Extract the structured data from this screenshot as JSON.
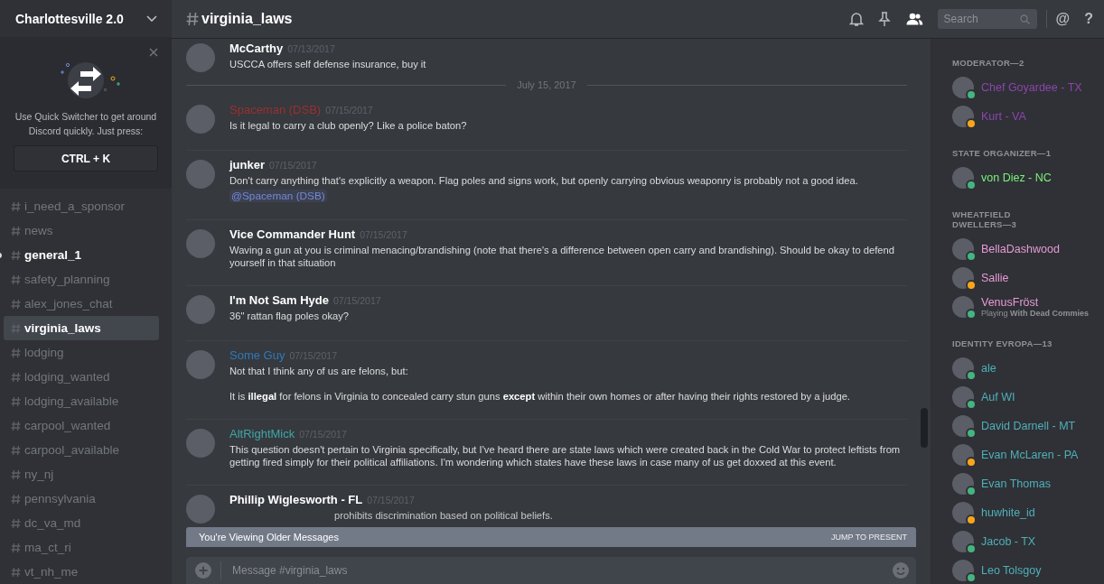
{
  "server": {
    "name": "Charlottesville 2.0"
  },
  "quick_switcher": {
    "text": "Use Quick Switcher to get around Discord quickly. Just press:",
    "shortcut": "CTRL + K"
  },
  "channels": [
    {
      "name": "i_need_a_sponsor",
      "unread": false,
      "selected": false
    },
    {
      "name": "news",
      "unread": false,
      "selected": false
    },
    {
      "name": "general_1",
      "unread": true,
      "selected": false
    },
    {
      "name": "safety_planning",
      "unread": false,
      "selected": false
    },
    {
      "name": "alex_jones_chat",
      "unread": false,
      "selected": false
    },
    {
      "name": "virginia_laws",
      "unread": false,
      "selected": true
    },
    {
      "name": "lodging",
      "unread": false,
      "selected": false
    },
    {
      "name": "lodging_wanted",
      "unread": false,
      "selected": false
    },
    {
      "name": "lodging_available",
      "unread": false,
      "selected": false
    },
    {
      "name": "carpool_wanted",
      "unread": false,
      "selected": false
    },
    {
      "name": "carpool_available",
      "unread": false,
      "selected": false
    },
    {
      "name": "ny_nj",
      "unread": false,
      "selected": false
    },
    {
      "name": "pennsylvania",
      "unread": false,
      "selected": false
    },
    {
      "name": "dc_va_md",
      "unread": false,
      "selected": false
    },
    {
      "name": "ma_ct_ri",
      "unread": false,
      "selected": false
    },
    {
      "name": "vt_nh_me",
      "unread": false,
      "selected": false
    }
  ],
  "header": {
    "channel": "virginia_laws",
    "search_placeholder": "Search",
    "mention_button": "@",
    "help_button": "?"
  },
  "messages": [
    {
      "kind": "message",
      "author": "McCarthy",
      "color": "#ffffff",
      "date": "07/13/2017",
      "lines": [
        {
          "kind": "text",
          "text": "USCCA offers self defense insurance, buy it"
        }
      ]
    },
    {
      "kind": "date_divider",
      "label": "July 15, 2017"
    },
    {
      "kind": "message",
      "author": "Spaceman (DSB)",
      "color": "#9a3030",
      "date": "07/15/2017",
      "lines": [
        {
          "kind": "text",
          "text": "Is it legal to carry a club openly? Like a police baton?"
        }
      ]
    },
    {
      "kind": "message",
      "author": "junker",
      "color": "#ffffff",
      "date": "07/15/2017",
      "lines": [
        {
          "kind": "text",
          "text": "Don't carry anything that's explicitly a weapon. Flag poles and signs work, but openly carrying obvious weaponry is probably not a good idea."
        },
        {
          "kind": "mention",
          "text": "@Spaceman (DSB)"
        }
      ]
    },
    {
      "kind": "message",
      "author": "Vice Commander Hunt",
      "color": "#ffffff",
      "date": "07/15/2017",
      "lines": [
        {
          "kind": "text",
          "text": "Waving a gun at you is criminal menacing/brandishing (note that there's a difference between open carry and brandishing). Should be okay to defend yourself in that situation"
        }
      ]
    },
    {
      "kind": "message",
      "author": "I'm Not Sam Hyde",
      "color": "#ffffff",
      "date": "07/15/2017",
      "lines": [
        {
          "kind": "text",
          "text": "36\" rattan flag poles okay?"
        }
      ]
    },
    {
      "kind": "message",
      "author": "Some Guy",
      "color": "#2f7ab8",
      "date": "07/15/2017",
      "lines": [
        {
          "kind": "text",
          "text": "Not that I think any of us are felons, but:"
        },
        {
          "kind": "text",
          "text": "It is **illegal** for felons in Virginia to concealed carry stun guns **except** within their own homes or after having their rights restored by a judge."
        }
      ]
    },
    {
      "kind": "message",
      "author": "AltRightMick",
      "color": "#3fa7a7",
      "date": "07/15/2017",
      "lines": [
        {
          "kind": "text",
          "text": "This question doesn't pertain to Virginia specifically, but I've heard there are state laws which were created back in the Cold War to protect leftists from getting fired simply for their political affiliations. I'm wondering which states have these laws in case many of us get doxxed at this event."
        }
      ]
    },
    {
      "kind": "message",
      "author": "Phillip Wiglesworth - FL",
      "color": "#ffffff",
      "date": "07/15/2017",
      "lines": [
        {
          "kind": "obscured",
          "text": "prohibits discrimination based on political beliefs."
        }
      ]
    }
  ],
  "older_banner": {
    "text": "You're Viewing Older Messages",
    "action": "JUMP TO PRESENT"
  },
  "composer": {
    "placeholder": "Message #virginia_laws"
  },
  "member_groups": [
    {
      "title": "MODERATOR—2",
      "color": "#8e44ad",
      "members": [
        {
          "name": "Chef Goyardee - TX",
          "color": "#43b581"
        },
        {
          "name": "Kurt - VA",
          "color": "#faa61a"
        }
      ]
    },
    {
      "title": "STATE ORGANIZER—1",
      "color": "#7cf07c",
      "members": [
        {
          "name": "von Diez - NC",
          "color": "#43b581"
        }
      ]
    },
    {
      "title": "WHEATFIELD DWELLERS—3",
      "color": "#e79ad6",
      "members": [
        {
          "name": "BellaDashwood",
          "color": "#43b581"
        },
        {
          "name": "Sallie",
          "color": "#faa61a"
        },
        {
          "name": "VenusFröst",
          "color": "#43b581",
          "activity": "Playing **With Dead Commies**"
        }
      ]
    },
    {
      "title": "IDENTITY EVROPA—13",
      "color": "#4fb0b8",
      "members": [
        {
          "name": "ale",
          "color": "#43b581"
        },
        {
          "name": "Auf WI",
          "color": "#43b581"
        },
        {
          "name": "David Darnell - MT",
          "color": "#43b581"
        },
        {
          "name": "Evan McLaren - PA",
          "color": "#faa61a"
        },
        {
          "name": "Evan Thomas",
          "color": "#43b581"
        },
        {
          "name": "huwhite_id",
          "color": "#faa61a"
        },
        {
          "name": "Jacob - TX",
          "color": "#43b581"
        },
        {
          "name": "Leo Tolsgoy",
          "color": "#43b581"
        }
      ]
    }
  ]
}
